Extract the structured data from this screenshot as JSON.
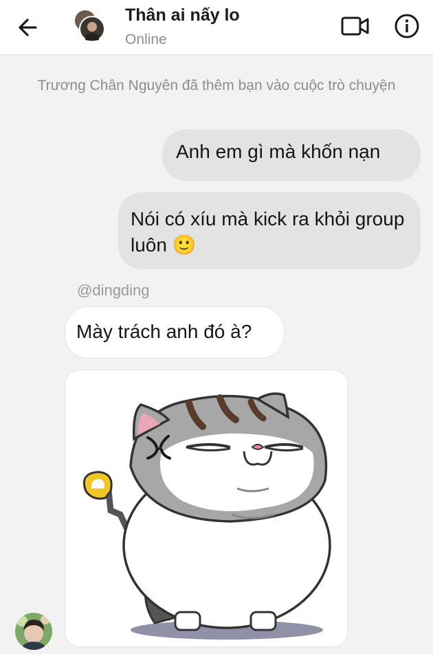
{
  "header": {
    "title": "Thân ai nấy lo",
    "status": "Online"
  },
  "icons": {
    "back": "arrow-left-icon",
    "video": "video-call-icon",
    "info": "info-icon"
  },
  "conversation": {
    "system_message": "Trương Chân Nguyên đã thêm bạn vào cuộc trò chuyện",
    "outgoing": [
      {
        "text": "Anh em gì mà khốn nạn"
      },
      {
        "text": "Nói có xíu mà kick ra khỏi group luôn 🙂"
      }
    ],
    "mention": "@dingding",
    "incoming": [
      {
        "text": "Mày trách anh đó à?"
      }
    ],
    "sticker": "angry-chubby-cat-sticker"
  },
  "colors": {
    "outgoing_bubble": "#e3e3e3",
    "incoming_bubble": "#ffffff",
    "background": "#f2f2f2"
  }
}
